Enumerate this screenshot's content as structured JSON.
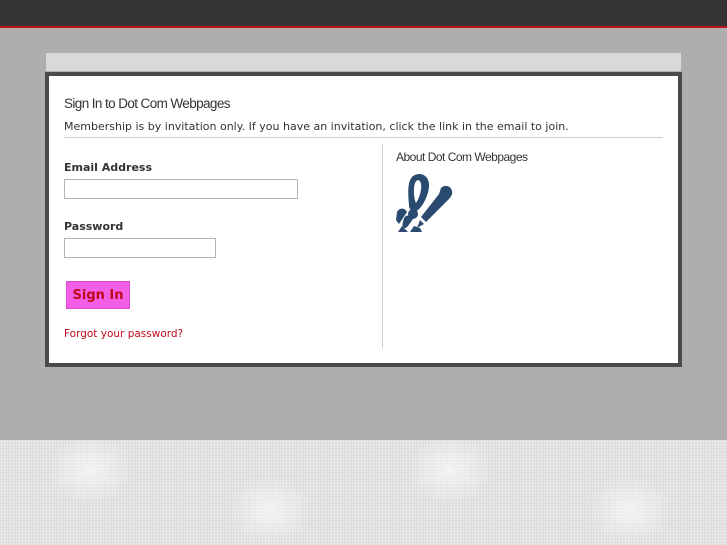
{
  "login": {
    "title": "Sign In to Dot Com Webpages",
    "subtitle": "Membership is by invitation only. If you have an invitation, click the link in the email to join.",
    "email_label": "Email Address",
    "email_value": "",
    "password_label": "Password",
    "password_value": "",
    "signin_label": "Sign In",
    "forgot_link": "Forgot your password?"
  },
  "about": {
    "title": "About Dot Com Webpages",
    "logo_icon": "pen-people-logo-icon"
  },
  "colors": {
    "accent_red": "#c00a1c",
    "button_pink": "#f25ee6",
    "logo_blue": "#2a4a70",
    "topbar": "#333333"
  }
}
